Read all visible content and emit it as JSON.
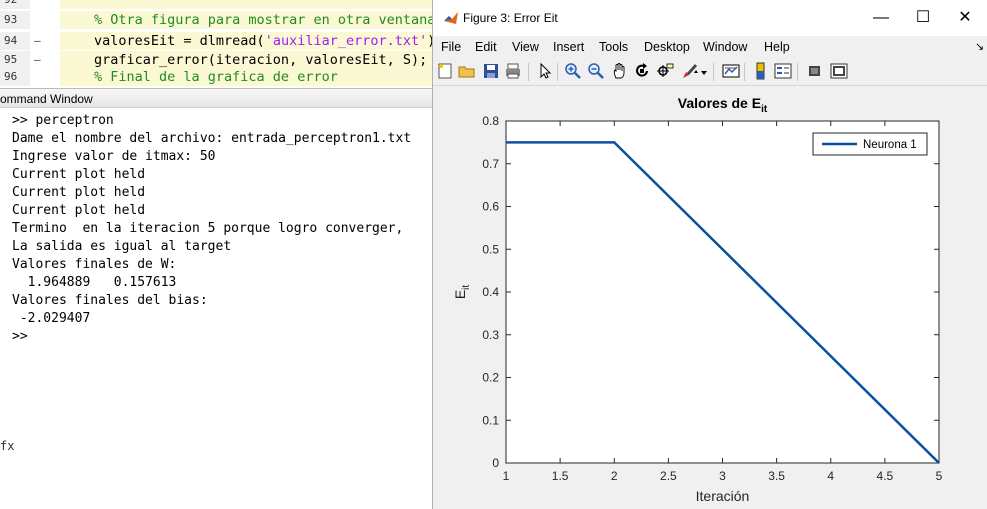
{
  "editor": {
    "lines": [
      {
        "num": "92",
        "mark": "",
        "code": ""
      },
      {
        "num": "93",
        "mark": "",
        "code_parts": [
          {
            "t": "% Otra figura para mostrar en otra ventana",
            "c": "cmt"
          }
        ]
      },
      {
        "num": "94",
        "mark": "–",
        "code_parts": [
          {
            "t": "valoresEit = dlmread(",
            "c": ""
          },
          {
            "t": "'auxiliar_error.txt'",
            "c": "str"
          },
          {
            "t": ")",
            "c": ""
          }
        ]
      },
      {
        "num": "95",
        "mark": "–",
        "code_parts": [
          {
            "t": "graficar_error(iteracion, valoresEit, S);",
            "c": ""
          }
        ]
      },
      {
        "num": "96",
        "mark": "",
        "code_parts": [
          {
            "t": "% Final de la grafica de error",
            "c": "cmt"
          }
        ]
      }
    ]
  },
  "command_window": {
    "title": "ommand Window",
    "lines": [
      ">> perceptron",
      "Dame el nombre del archivo: entrada_perceptron1.txt",
      "Ingrese valor de itmax: 50",
      "Current plot held",
      "Current plot held",
      "Current plot held",
      "Termino  en la iteracion 5 porque logro converger,",
      "La salida es igual al target",
      "Valores finales de W:",
      "  1.964889   0.157613",
      "Valores finales del bias:",
      " -2.029407",
      ">>"
    ],
    "edge_mark": "fx"
  },
  "figure": {
    "title": "Figure 3: Error Eit",
    "controls": {
      "minimize": "—",
      "maximize": "☐",
      "close": "✕"
    },
    "menu": [
      "File",
      "Edit",
      "View",
      "Insert",
      "Tools",
      "Desktop",
      "Window",
      "Help"
    ],
    "menu_arrow": "↘",
    "toolbar_icons": [
      "new-figure-icon",
      "open-file-icon",
      "save-icon",
      "print-icon",
      "pointer-icon",
      "zoom-in-icon",
      "zoom-out-icon",
      "pan-icon",
      "rotate-icon",
      "data-cursor-icon",
      "brush-icon",
      "link-plot-icon",
      "colorbar-icon",
      "legend-icon",
      "hide-plot-tools-icon",
      "show-plot-tools-icon"
    ]
  },
  "chart_data": {
    "type": "line",
    "title": "Valores de E",
    "title_sub": "it",
    "xlabel": "Iteración",
    "ylabel": "E",
    "ylabel_sub": "it",
    "xlim": [
      1,
      5
    ],
    "ylim": [
      0,
      0.8
    ],
    "xticks": [
      "1",
      "1.5",
      "2",
      "2.5",
      "3",
      "3.5",
      "4",
      "4.5",
      "5"
    ],
    "yticks": [
      "0",
      "0.1",
      "0.2",
      "0.3",
      "0.4",
      "0.5",
      "0.6",
      "0.7",
      "0.8"
    ],
    "legend_position": "top-right",
    "grid": false,
    "series": [
      {
        "name": "Neurona 1",
        "color": "#0b4fa0",
        "x": [
          1,
          2,
          3,
          4,
          5
        ],
        "y": [
          0.75,
          0.75,
          0.5,
          0.25,
          0
        ]
      }
    ]
  }
}
